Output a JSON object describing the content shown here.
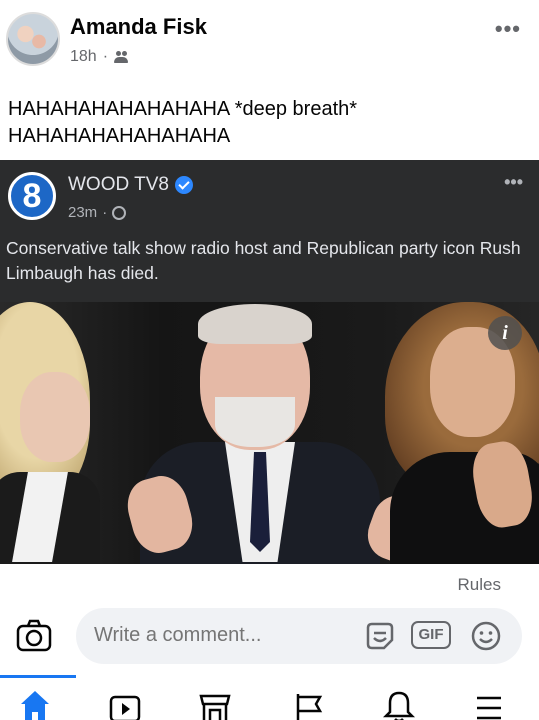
{
  "post": {
    "author": "Amanda Fisk",
    "time": "18h",
    "separator": "·",
    "more": "•••",
    "text": "HAHAHAHAHAHAHAHA *deep breath* HAHAHAHAHAHAHAHA"
  },
  "shared_post": {
    "page_name": "WOOD TV8",
    "logo_glyph": "8",
    "time": "23m",
    "separator": "·",
    "more": "•••",
    "text": "Conservative talk show radio host and Republican party icon Rush Limbaugh has died."
  },
  "photo": {
    "info_badge": "i"
  },
  "rules_label": "Rules",
  "comment_bar": {
    "placeholder": "Write a comment...",
    "gif_label": "GIF"
  },
  "icons": {
    "audience": "friends-icon",
    "verified": "verified-badge-icon",
    "globe": "globe-icon",
    "camera": "camera-icon",
    "sticker": "sticker-icon",
    "emoji": "emoji-icon",
    "nav": [
      "home-icon",
      "watch-icon",
      "marketplace-icon",
      "pages-flag-icon",
      "notifications-bell-icon",
      "menu-icon"
    ]
  },
  "colors": {
    "accent": "#1877f2",
    "shared_bg": "#2b2c2d",
    "secondary_text": "#65676b",
    "verified": "#2d88ff"
  }
}
